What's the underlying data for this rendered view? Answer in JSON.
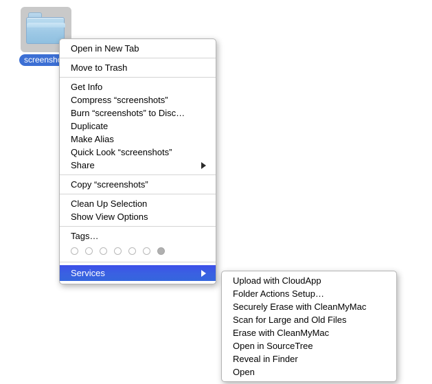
{
  "desktop": {
    "icon": {
      "name": "screenshots",
      "type": "folder",
      "selected": true,
      "label_background_color": "#3c6fd4",
      "selection_background_color": "#c9c9c9"
    }
  },
  "context_menu": {
    "groups": [
      {
        "items": [
          {
            "label": "Open in New Tab",
            "has_submenu": false,
            "highlighted": false
          }
        ]
      },
      {
        "items": [
          {
            "label": "Move to Trash",
            "has_submenu": false,
            "highlighted": false
          }
        ]
      },
      {
        "items": [
          {
            "label": "Get Info",
            "has_submenu": false,
            "highlighted": false
          },
          {
            "label": "Compress “screenshots”",
            "has_submenu": false,
            "highlighted": false
          },
          {
            "label": "Burn “screenshots” to Disc…",
            "has_submenu": false,
            "highlighted": false
          },
          {
            "label": "Duplicate",
            "has_submenu": false,
            "highlighted": false
          },
          {
            "label": "Make Alias",
            "has_submenu": false,
            "highlighted": false
          },
          {
            "label": "Quick Look “screenshots”",
            "has_submenu": false,
            "highlighted": false
          },
          {
            "label": "Share",
            "has_submenu": true,
            "highlighted": false
          }
        ]
      },
      {
        "items": [
          {
            "label": "Copy “screenshots”",
            "has_submenu": false,
            "highlighted": false
          }
        ]
      },
      {
        "items": [
          {
            "label": "Clean Up Selection",
            "has_submenu": false,
            "highlighted": false
          },
          {
            "label": "Show View Options",
            "has_submenu": false,
            "highlighted": false
          }
        ]
      },
      {
        "items": [
          {
            "label": "Tags…",
            "has_submenu": false,
            "highlighted": false
          }
        ],
        "tags": [
          {
            "color": "none",
            "filled": false
          },
          {
            "color": "none",
            "filled": false
          },
          {
            "color": "none",
            "filled": false
          },
          {
            "color": "none",
            "filled": false
          },
          {
            "color": "none",
            "filled": false
          },
          {
            "color": "none",
            "filled": false
          },
          {
            "color": "#b0b0b0",
            "filled": true
          }
        ]
      },
      {
        "items": [
          {
            "label": "Services",
            "has_submenu": true,
            "highlighted": true
          }
        ]
      }
    ],
    "highlight_color": "#3d4fe9"
  },
  "services_submenu": {
    "items": [
      {
        "label": "Upload with CloudApp"
      },
      {
        "label": "Folder Actions Setup…"
      },
      {
        "label": "Securely Erase with CleanMyMac"
      },
      {
        "label": "Scan for Large and Old Files"
      },
      {
        "label": "Erase with CleanMyMac"
      },
      {
        "label": "Open in SourceTree"
      },
      {
        "label": "Reveal in Finder"
      },
      {
        "label": "Open"
      }
    ]
  }
}
